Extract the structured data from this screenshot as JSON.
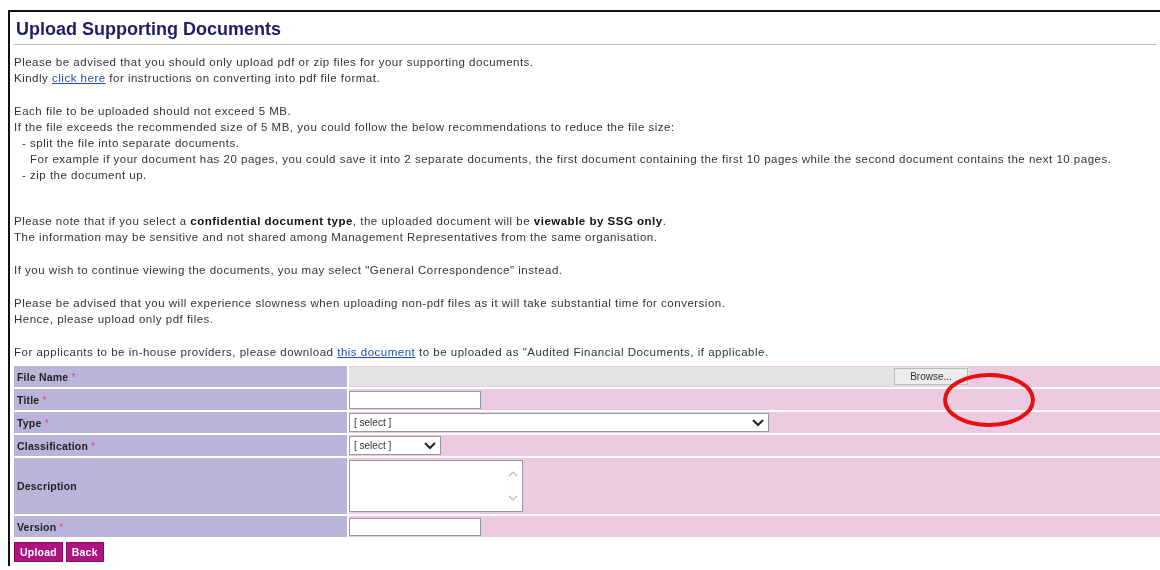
{
  "title": "Upload Supporting Documents",
  "notices": [
    [
      {
        "kind": "line",
        "parts": [
          {
            "text": "Please be advised that you should only upload pdf or zip files for your supporting documents."
          }
        ]
      },
      {
        "kind": "line",
        "parts": [
          {
            "text": "Kindly "
          },
          {
            "link": "click here"
          },
          {
            "text": " for instructions on converting into pdf file format."
          }
        ]
      }
    ],
    [
      {
        "kind": "line",
        "parts": [
          {
            "text": "Each file to be uploaded should not exceed 5 MB."
          }
        ]
      },
      {
        "kind": "line",
        "parts": [
          {
            "text": "If the file exceeds the recommended size of 5 MB, you could follow the below recommendations to reduce the file size:"
          }
        ]
      },
      {
        "kind": "item",
        "parts": [
          {
            "text": "- split the file into separate documents."
          }
        ]
      },
      {
        "kind": "item-note",
        "parts": [
          {
            "text": "For example if your document has 20 pages, you could save it into 2 separate documents, the first document containing the first 10 pages while the second document contains the next 10 pages."
          }
        ]
      },
      {
        "kind": "item",
        "parts": [
          {
            "text": "- zip the document up."
          }
        ]
      }
    ],
    [
      {
        "kind": "line",
        "parts": [
          {
            "text": "Please note that if you select a **confidential document type**, the uploaded document will be **viewable by SSG only**."
          }
        ]
      },
      {
        "kind": "line",
        "parts": [
          {
            "text": "The information may be sensitive and not shared among Management Representatives from the same organisation."
          }
        ]
      }
    ],
    [
      {
        "kind": "line",
        "parts": [
          {
            "text": "If you wish to continue viewing the documents, you may select \"General Correspondence\" instead."
          }
        ]
      }
    ],
    [
      {
        "kind": "line",
        "parts": [
          {
            "text": "Please be advised that you will experience slowness when uploading non-pdf files as it will take substantial time for conversion."
          }
        ]
      },
      {
        "kind": "line",
        "parts": [
          {
            "text": "Hence, please upload only pdf files."
          }
        ]
      }
    ],
    [
      {
        "kind": "line",
        "parts": [
          {
            "text": "For applicants to be in-house providers, please download "
          },
          {
            "link": "this document"
          },
          {
            "text": " to be uploaded as \"Audited Financial Documents, if applicable."
          }
        ]
      }
    ]
  ],
  "form": [
    {
      "label": "File Name",
      "mark": "*",
      "kind": "file",
      "button": "Browse..."
    },
    {
      "label": "Title",
      "mark": "*",
      "kind": "text"
    },
    {
      "label": "Type",
      "mark": "*",
      "kind": "select-wide",
      "value": "[ select ]"
    },
    {
      "label": "Classification",
      "mark": "*",
      "kind": "select",
      "value": "[ select ]"
    },
    {
      "label": "Description",
      "kind": "textarea"
    },
    {
      "label": "Version",
      "mark": "*",
      "kind": "text"
    }
  ],
  "buttons": [
    "Upload",
    "Back"
  ],
  "annotation": {
    "kind": "ellipse",
    "color": "#e8100f"
  }
}
